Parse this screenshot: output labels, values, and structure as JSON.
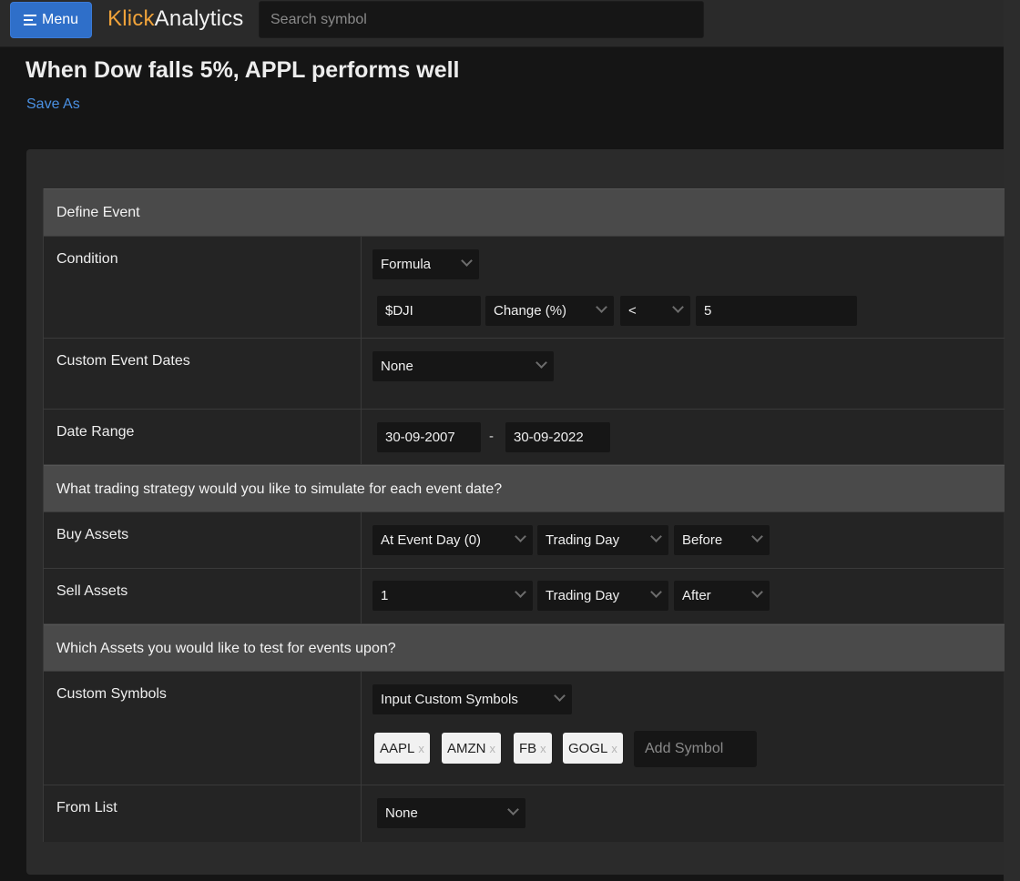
{
  "topbar": {
    "menu_label": "Menu",
    "brand_part1": "Klick",
    "brand_part2": "Analytics",
    "search_placeholder": "Search symbol"
  },
  "page": {
    "title": "When Dow falls 5%, APPL performs well",
    "save_as": "Save As"
  },
  "sections": {
    "define_event": "Define Event",
    "strategy": "What trading strategy would you like to simulate for each event date?",
    "assets": "Which Assets you would like to test for events upon?"
  },
  "condition": {
    "label": "Condition",
    "type": "Formula",
    "symbol": "$DJI",
    "metric": "Change (%)",
    "operator": "<",
    "value": "5"
  },
  "custom_event_dates": {
    "label": "Custom Event Dates",
    "value": "None"
  },
  "date_range": {
    "label": "Date Range",
    "start": "30-09-2007",
    "separator": "-",
    "end": "30-09-2022"
  },
  "buy_assets": {
    "label": "Buy Assets",
    "day": "At Event Day (0)",
    "unit": "Trading Day",
    "direction": "Before"
  },
  "sell_assets": {
    "label": "Sell Assets",
    "day": "1",
    "unit": "Trading Day",
    "direction": "After"
  },
  "custom_symbols": {
    "label": "Custom Symbols",
    "mode": "Input Custom Symbols",
    "tags": [
      "AAPL",
      "AMZN",
      "FB",
      "GOGL"
    ],
    "remove_glyph": "x",
    "add_placeholder": "Add Symbol"
  },
  "from_list": {
    "label": "From List",
    "value": "None"
  },
  "colors": {
    "accent": "#2f6fc9",
    "brand_orange": "#f0a33a",
    "link": "#4a90e2",
    "section_header": "#4a4a4a"
  }
}
